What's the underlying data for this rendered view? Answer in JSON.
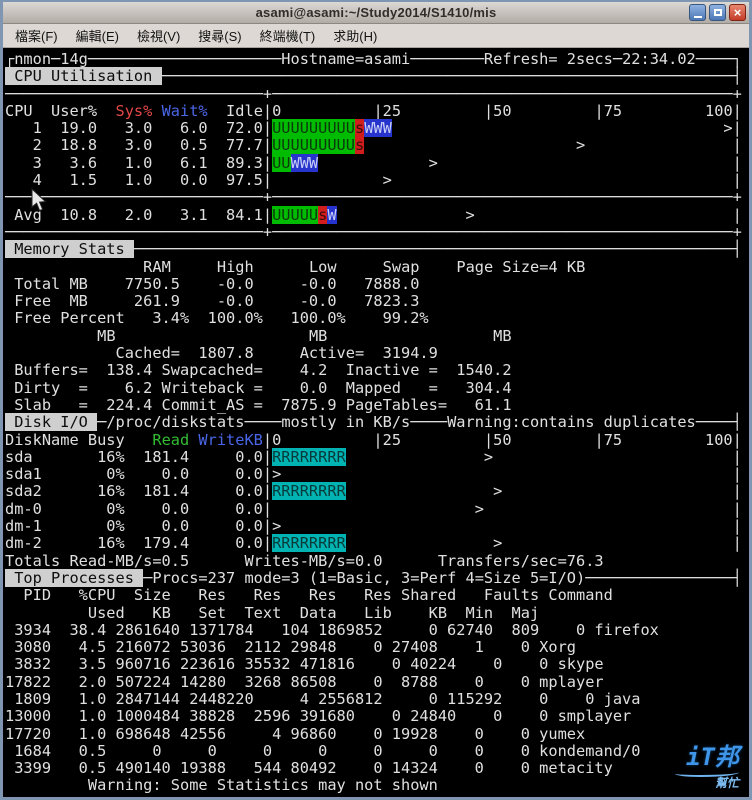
{
  "window_title": "asami@asami:~/Study2014/S1410/mis",
  "window_buttons": {
    "close_glyph": "×"
  },
  "menu_items": [
    {
      "label": "檔案(F)"
    },
    {
      "label": "編輯(E)"
    },
    {
      "label": "檢視(V)"
    },
    {
      "label": "搜尋(S)"
    },
    {
      "label": "終端機(T)"
    },
    {
      "label": "求助(H)"
    }
  ],
  "colors": {
    "red": "#e24848",
    "green": "#33bd33",
    "blue": "#4a66e8",
    "revbg": "#cfcfcf",
    "ubg": "#00bc00",
    "sbg": "#d21d1d",
    "wbg": "#2633cd",
    "rbg": "#00b3b3"
  },
  "watermark": {
    "text_top": "iT邦",
    "text_bottom": "幫忙"
  },
  "terminal": {
    "lines": [
      [
        {
          "t": "┌nmon─14g"
        },
        {
          "rep": "─",
          "n": 21
        },
        {
          "t": "Hostname=asami"
        },
        {
          "rep": "─",
          "n": 8
        },
        {
          "t": "Refresh= 2secs"
        },
        {
          "rep": "─",
          "n": 1
        },
        {
          "t": "22:34.02"
        },
        {
          "rep": "─",
          "n": 4
        },
        {
          "t": "┐"
        }
      ],
      [
        {
          "c": "rev",
          "t": " CPU Utilisation "
        },
        {
          "rep": "─",
          "n": 62
        },
        {
          "t": "┤"
        }
      ],
      [
        {
          "rep": "─",
          "n": 28
        },
        {
          "t": "+"
        },
        {
          "rep": "─",
          "n": 50
        },
        {
          "t": "+"
        }
      ],
      [
        {
          "t": "CPU  User%  "
        },
        {
          "c": "r",
          "t": "Sys%"
        },
        {
          "t": " "
        },
        {
          "c": "b",
          "t": "Wait%"
        },
        {
          "t": "  Idle"
        },
        {
          "t": "|0"
        },
        {
          "rep": " ",
          "n": 10
        },
        {
          "t": "|25"
        },
        {
          "rep": " ",
          "n": 9
        },
        {
          "t": "|50"
        },
        {
          "rep": " ",
          "n": 9
        },
        {
          "t": "|75"
        },
        {
          "rep": " ",
          "n": 9
        },
        {
          "t": "100|"
        }
      ],
      [
        {
          "t": "   1  19.0   3.0   6.0  72.0|"
        },
        {
          "c": "bu",
          "t": "UUUUUUUUU"
        },
        {
          "c": "bs",
          "t": "s"
        },
        {
          "c": "bw",
          "t": "WWW"
        },
        {
          "rep": " ",
          "n": 36
        },
        {
          "t": ">|"
        }
      ],
      [
        {
          "t": "   2  18.8   3.0   0.5  77.7|"
        },
        {
          "c": "bu",
          "t": "UUUUUUUUU"
        },
        {
          "c": "bs",
          "t": "s"
        },
        {
          "rep": " ",
          "n": 23
        },
        {
          "t": ">"
        },
        {
          "rep": " ",
          "n": 16
        },
        {
          "t": "|"
        }
      ],
      [
        {
          "t": "   3   3.6   1.0   6.1  89.3|"
        },
        {
          "c": "bu",
          "t": "UU"
        },
        {
          "c": "bw",
          "t": "WWW"
        },
        {
          "rep": " ",
          "n": 12
        },
        {
          "t": ">"
        },
        {
          "rep": " ",
          "n": 32
        },
        {
          "t": "|"
        }
      ],
      [
        {
          "t": "   4   1.5   1.0   0.0  97.5|"
        },
        {
          "rep": " ",
          "n": 12
        },
        {
          "t": ">"
        },
        {
          "rep": " ",
          "n": 37
        },
        {
          "t": "|"
        }
      ],
      [
        {
          "rep": "─",
          "n": 28
        },
        {
          "t": "+"
        },
        {
          "rep": "─",
          "n": 50
        },
        {
          "t": "+"
        }
      ],
      [
        {
          "t": " Avg  10.8   2.0   3.1  84.1|"
        },
        {
          "c": "bu",
          "t": "UUUUU"
        },
        {
          "c": "bs",
          "t": "s"
        },
        {
          "c": "bw",
          "t": "W"
        },
        {
          "rep": " ",
          "n": 14
        },
        {
          "t": ">"
        },
        {
          "rep": " ",
          "n": 28
        },
        {
          "t": "|"
        }
      ],
      [
        {
          "rep": "─",
          "n": 28
        },
        {
          "t": "+"
        },
        {
          "rep": "─",
          "n": 50
        },
        {
          "t": "+"
        }
      ],
      [
        {
          "c": "rev",
          "t": " Memory Stats "
        },
        {
          "rep": "─",
          "n": 65
        },
        {
          "t": "┤"
        }
      ],
      [
        {
          "rep": " ",
          "n": 15
        },
        {
          "t": "RAM"
        },
        {
          "rep": " ",
          "n": 5
        },
        {
          "t": "High"
        },
        {
          "rep": " ",
          "n": 6
        },
        {
          "t": "Low"
        },
        {
          "rep": " ",
          "n": 5
        },
        {
          "t": "Swap"
        },
        {
          "rep": " ",
          "n": 4
        },
        {
          "t": "Page Size=4 KB"
        }
      ],
      [
        {
          "t": " Total MB    7750.5    -0.0     -0.0   7888.0"
        }
      ],
      [
        {
          "t": " Free  MB     261.9    -0.0     -0.0   7823.3"
        }
      ],
      [
        {
          "t": " Free Percent   3.4%  100.0%   100.0%    99.2%"
        }
      ],
      [
        {
          "rep": " ",
          "n": 10
        },
        {
          "t": "MB"
        },
        {
          "rep": " ",
          "n": 21
        },
        {
          "t": "MB"
        },
        {
          "rep": " ",
          "n": 18
        },
        {
          "t": "MB"
        }
      ],
      [
        {
          "rep": " ",
          "n": 12
        },
        {
          "t": "Cached=  1807.8     Active=  3194.9"
        }
      ],
      [
        {
          "t": " Buffers=  138.4 Swapcached=    4.2  Inactive =  1540.2"
        }
      ],
      [
        {
          "t": " Dirty  =    6.2 Writeback =    0.0  Mapped   =   304.4"
        }
      ],
      [
        {
          "t": " Slab   =  224.4 Commit_AS =  7875.9 PageTables=   61.1"
        }
      ],
      [
        {
          "c": "rev",
          "t": " Disk I/O "
        },
        {
          "t": "─/proc/diskstats"
        },
        {
          "rep": "─",
          "n": 4
        },
        {
          "t": "mostly in KB/s"
        },
        {
          "rep": "─",
          "n": 4
        },
        {
          "t": "Warning:contains duplicates"
        },
        {
          "rep": "─",
          "n": 4
        },
        {
          "t": "┤"
        }
      ],
      [
        {
          "t": "DiskName Busy   "
        },
        {
          "c": "g",
          "t": "Read"
        },
        {
          "t": " "
        },
        {
          "c": "b",
          "t": "WriteKB"
        },
        {
          "t": "|0"
        },
        {
          "rep": " ",
          "n": 10
        },
        {
          "t": "|25"
        },
        {
          "rep": " ",
          "n": 9
        },
        {
          "t": "|50"
        },
        {
          "rep": " ",
          "n": 9
        },
        {
          "t": "|75"
        },
        {
          "rep": " ",
          "n": 9
        },
        {
          "t": "100|"
        }
      ],
      [
        {
          "t": "sda       16%  181.4     0.0|"
        },
        {
          "c": "br",
          "t": "RRRRRRRR"
        },
        {
          "rep": " ",
          "n": 15
        },
        {
          "t": ">"
        },
        {
          "rep": " ",
          "n": 26
        },
        {
          "t": "|"
        }
      ],
      [
        {
          "t": "sda1       0%    0.0     0.0|"
        },
        {
          "t": ">"
        },
        {
          "rep": " ",
          "n": 49
        },
        {
          "t": "|"
        }
      ],
      [
        {
          "t": "sda2      16%  181.4     0.0|"
        },
        {
          "c": "br",
          "t": "RRRRRRRR"
        },
        {
          "rep": " ",
          "n": 16
        },
        {
          "t": ">"
        },
        {
          "rep": " ",
          "n": 25
        },
        {
          "t": "|"
        }
      ],
      [
        {
          "t": "dm-0       0%    0.0     0.0|"
        },
        {
          "rep": " ",
          "n": 22
        },
        {
          "t": ">"
        },
        {
          "rep": " ",
          "n": 27
        },
        {
          "t": "|"
        }
      ],
      [
        {
          "t": "dm-1       0%    0.0     0.0|"
        },
        {
          "t": ">"
        },
        {
          "rep": " ",
          "n": 49
        },
        {
          "t": "|"
        }
      ],
      [
        {
          "t": "dm-2      16%  179.4     0.0|"
        },
        {
          "c": "br",
          "t": "RRRRRRRR"
        },
        {
          "rep": " ",
          "n": 16
        },
        {
          "t": ">"
        },
        {
          "rep": " ",
          "n": 25
        },
        {
          "t": "|"
        }
      ],
      [
        {
          "t": "Totals Read-MB/s=0.5      Writes-MB/s=0.0      Transfers/sec=76.3"
        }
      ],
      [
        {
          "c": "rev",
          "t": " Top Processes "
        },
        {
          "t": "─Procs=237 mode=3 (1=Basic, 3=Perf 4=Size 5=I/O)"
        },
        {
          "rep": "─",
          "n": 16
        },
        {
          "t": "┤"
        }
      ],
      [
        {
          "t": "  PID   %CPU  Size   Res   Res   Res   Res Shared   Faults Command"
        }
      ],
      [
        {
          "rep": " ",
          "n": 9
        },
        {
          "t": "Used   KB   Set  Text  Data   Lib    KB  Min  Maj"
        }
      ],
      [
        {
          "t": " 3934  38.4 2861640 1371784   104 1869852     0 62740  809    0 firefox"
        }
      ],
      [
        {
          "t": " 3080   4.5 216072 53036  2112 29848    0 27408    1    0 Xorg"
        }
      ],
      [
        {
          "t": " 3832   3.5 960716 223616 35532 471816    0 40224    0    0 skype"
        }
      ],
      [
        {
          "t": "17822   2.0 507224 14280  3268 86508    0  8788    0    0 mplayer"
        }
      ],
      [
        {
          "t": " 1809   1.0 2847144 2448220     4 2556812     0 115292    0    0 java"
        }
      ],
      [
        {
          "t": "13000   1.0 1000484 38828  2596 391680    0 24840    0    0 smplayer"
        }
      ],
      [
        {
          "t": "17720   1.0 698648 42556     4 96860    0 19928    0    0 yumex"
        }
      ],
      [
        {
          "t": " 1684   0.5     0     0     0     0     0     0    0    0 kondemand/0"
        }
      ],
      [
        {
          "t": " 3399   0.5 490140 19388   544 80492    0 14324    0    0 metacity"
        }
      ],
      [
        {
          "rep": " ",
          "n": 9
        },
        {
          "t": "Warning: Some Statistics may not shown"
        }
      ]
    ]
  }
}
